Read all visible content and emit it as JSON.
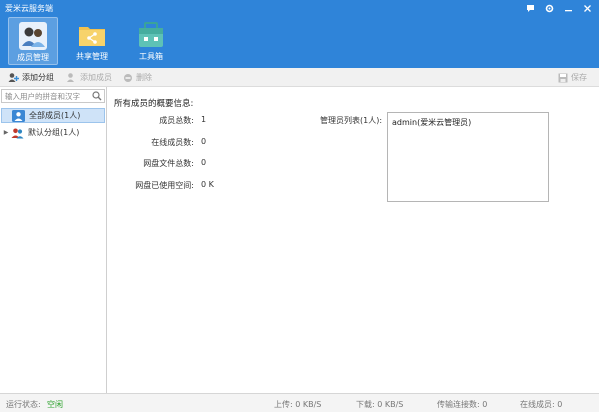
{
  "window": {
    "title": "爱米云服务端"
  },
  "main_nav": [
    {
      "label": "成员管理"
    },
    {
      "label": "共享管理"
    },
    {
      "label": "工具箱"
    }
  ],
  "toolbar": {
    "add_group": "添加分组",
    "add_member": "添加成员",
    "delete": "删除",
    "save": "保存"
  },
  "sidebar": {
    "search_placeholder": "输入用户的拼音和汉字",
    "tree": [
      {
        "label": "全部成员(1人)"
      },
      {
        "label": "默认分组(1人)"
      }
    ]
  },
  "overview": {
    "title": "所有成员的概要信息:",
    "stats": [
      {
        "label": "成员总数:",
        "value": "1"
      },
      {
        "label": "在线成员数:",
        "value": "0"
      },
      {
        "label": "网盘文件总数:",
        "value": "0"
      },
      {
        "label": "网盘已使用空间:",
        "value": "0 K"
      }
    ],
    "admin_label": "管理员列表(1人):",
    "admins": [
      "admin(爱米云管理员)"
    ]
  },
  "statusbar": {
    "run_status_label": "运行状态:",
    "run_status_value": "空闲",
    "upload": "上传: 0 KB/S",
    "download": "下载: 0 KB/S",
    "connections": "传输连接数: 0",
    "online_members": "在线成员: 0"
  },
  "colors": {
    "titlebar": "#2f84d9",
    "selected_bg": "#cfe3f8",
    "status_ok": "#2aa12a"
  }
}
